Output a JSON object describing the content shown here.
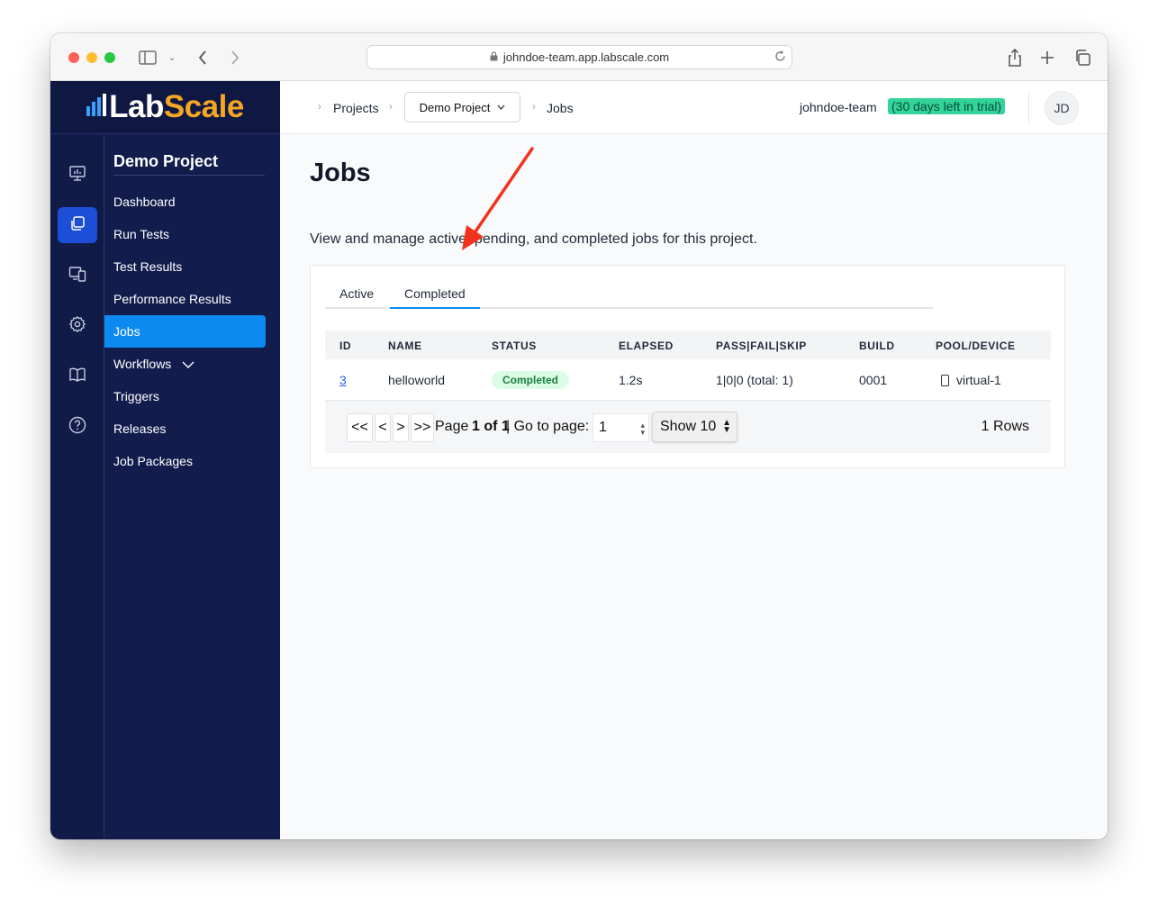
{
  "browser": {
    "url": "johndoe-team.app.labscale.com"
  },
  "brand": {
    "logo_lab": "Lab",
    "logo_scale": "Scale",
    "accent": "#f5a623"
  },
  "subnav": {
    "title": "Demo Project",
    "items": [
      {
        "label": "Dashboard"
      },
      {
        "label": "Run Tests"
      },
      {
        "label": "Test Results"
      },
      {
        "label": "Performance Results"
      },
      {
        "label": "Jobs",
        "active": true
      },
      {
        "label": "Workflows"
      },
      {
        "label": "Triggers"
      },
      {
        "label": "Releases"
      },
      {
        "label": "Job Packages"
      }
    ]
  },
  "header": {
    "crumb_projects": "Projects",
    "project_select": "Demo Project",
    "crumb_jobs": "Jobs",
    "team": "johndoe-team",
    "trial": "(30 days left in trial)",
    "avatar": "JD"
  },
  "page": {
    "title": "Jobs",
    "description": "View and manage active, pending, and completed jobs for this project."
  },
  "tabs": [
    {
      "label": "Active"
    },
    {
      "label": "Completed",
      "active": true
    }
  ],
  "table": {
    "columns": [
      "ID",
      "NAME",
      "STATUS",
      "ELAPSED",
      "PASS|FAIL|SKIP",
      "BUILD",
      "POOL/DEVICE"
    ],
    "rows": [
      {
        "id": "3",
        "name": "helloworld",
        "status": "Completed",
        "elapsed": "1.2s",
        "pfs": "1|0|0 (total: 1)",
        "build": "0001",
        "device": "virtual-1"
      }
    ]
  },
  "pager": {
    "first": "<<",
    "prev": "<",
    "next": ">",
    "last": ">>",
    "page_label": "Page",
    "page_of": "1 of 1",
    "goto_label": "| Go to page:",
    "goto_value": "1",
    "show": "Show 10",
    "rows": "1 Rows"
  },
  "colors": {
    "sidebar": "#121d4d",
    "active_blue": "#0d8af0",
    "status_green": "#15803d",
    "annotation_arrow": "#f0321e"
  }
}
